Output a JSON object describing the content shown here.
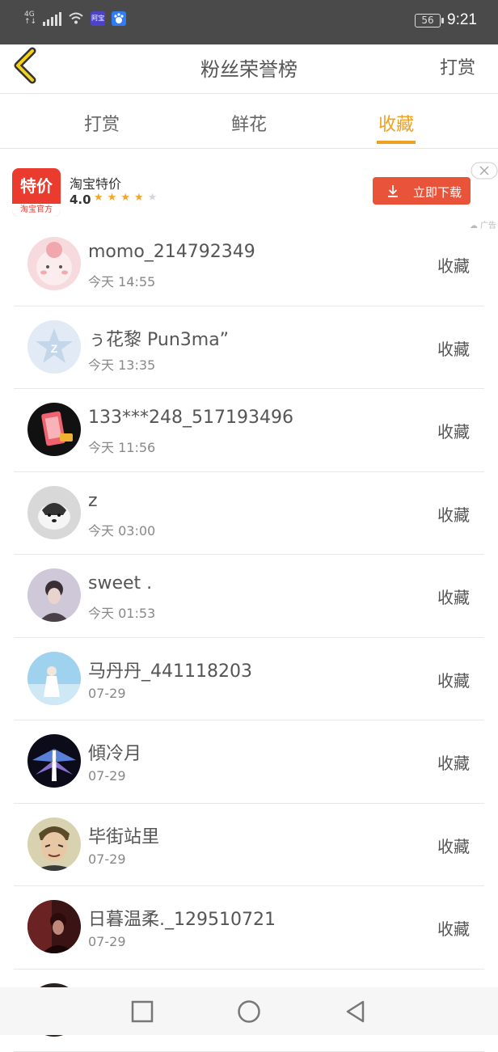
{
  "status_bar": {
    "network_top": "4G",
    "network_bottom": "↑↓",
    "badge1_text": "阿宝",
    "battery": "56",
    "time": "9:21"
  },
  "header": {
    "title": "粉丝荣誉榜",
    "action": "打赏",
    "back_icon": "chevron-left-icon"
  },
  "tabs": [
    {
      "label": "打赏",
      "active": false
    },
    {
      "label": "鲜花",
      "active": false
    },
    {
      "label": "收藏",
      "active": true
    }
  ],
  "ad": {
    "logo_main": "特价",
    "logo_sub": "淘宝官方",
    "title": "淘宝特价",
    "rating": "4.0",
    "stars_filled": 4,
    "stars_total": 5,
    "button": "立即下载",
    "tag": "广告"
  },
  "list": [
    {
      "name": "momo_214792349",
      "time": "今天 14:55",
      "action": "收藏"
    },
    {
      "name": "ぅ花黎 Pun3ma”",
      "time": "今天 13:35",
      "action": "收藏"
    },
    {
      "name": "133***248_517193496",
      "time": "今天 11:56",
      "action": "收藏"
    },
    {
      "name": "z",
      "time": "今天 03:00",
      "action": "收藏"
    },
    {
      "name": "sweet .",
      "time": "今天 01:53",
      "action": "收藏"
    },
    {
      "name": "马丹丹_441118203",
      "time": "07-29",
      "action": "收藏"
    },
    {
      "name": "傾冷月",
      "time": "07-29",
      "action": "收藏"
    },
    {
      "name": "毕街站里",
      "time": "07-29",
      "action": "收藏"
    },
    {
      "name": "日暮温柔._129510721",
      "time": "07-29",
      "action": "收藏"
    }
  ],
  "colors": {
    "accent": "#f0a020",
    "ad_red": "#e8533a",
    "status_bar": "#4a4a4a"
  }
}
